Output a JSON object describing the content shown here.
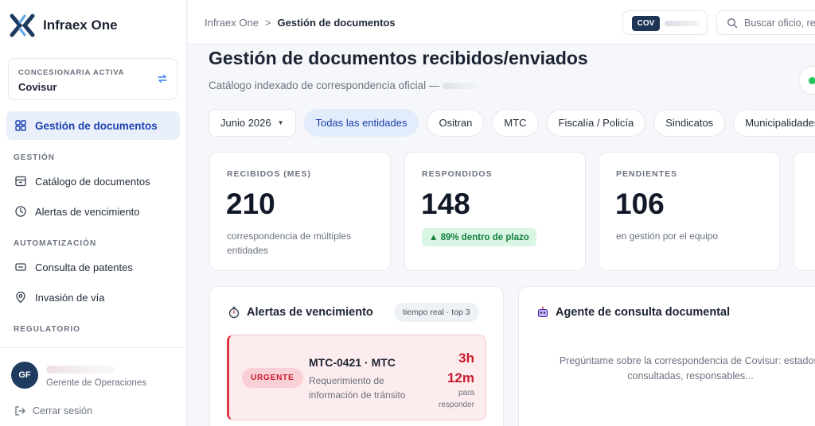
{
  "app": {
    "name": "Infraex One"
  },
  "concesionaria": {
    "label": "CONCESIONARIA ACTIVA",
    "name": "Covisur"
  },
  "sidebar": {
    "active_item": "Gestión de documentos",
    "sections": [
      {
        "title": "GESTIÓN",
        "items": [
          "Catálogo de documentos",
          "Alertas de vencimiento"
        ]
      },
      {
        "title": "AUTOMATIZACIÓN",
        "items": [
          "Consulta de patentes",
          "Invasión de vía"
        ]
      },
      {
        "title": "REGULATORIO",
        "items": []
      }
    ]
  },
  "user": {
    "initials": "GF",
    "role": "Gerente de Operaciones",
    "logout": "Cerrar sesión"
  },
  "header": {
    "breadcrumb_root": "Infraex One",
    "breadcrumb_sep": ">",
    "breadcrumb_current": "Gestión de documentos",
    "cov_badge": "COV",
    "search_placeholder": "Buscar oficio, re"
  },
  "page": {
    "title": "Gestión de documentos recibidos/enviados",
    "subtitle": "Catálogo indexado de correspondencia oficial —"
  },
  "filters": {
    "month": "Junio 2026",
    "chips": [
      "Todas las entidades",
      "Ositran",
      "MTC",
      "Fiscalía / Policía",
      "Sindicatos",
      "Municipalidades"
    ],
    "active_chip": "Todas las entidades"
  },
  "stats": [
    {
      "label": "RECIBIDOS (MES)",
      "value": "210",
      "desc": "correspondencia de múltiples entidades"
    },
    {
      "label": "RESPONDIDOS",
      "value": "148",
      "pill": "▲ 89% dentro de plazo"
    },
    {
      "label": "PENDIENTES",
      "value": "106",
      "desc": "en gestión por el equipo"
    }
  ],
  "alerts_panel": {
    "title": "Alertas de vencimiento",
    "tag": "tiempo real · top 3",
    "alert": {
      "badge": "URGENTE",
      "title": "MTC-0421 · MTC",
      "desc": "Requerimiento de información de tránsito",
      "time_h": "3h",
      "time_m": "12m",
      "note": "para responder"
    }
  },
  "agent_panel": {
    "title": "Agente de consulta documental",
    "text_line1": "Pregúntame sobre la correspondencia de Covisur: estados,",
    "text_line2": "consultadas, responsables..."
  },
  "colors": {
    "accent": "#1e40af",
    "urgent": "#c8192d",
    "success": "#15803d",
    "brand_dark": "#1e3556"
  }
}
